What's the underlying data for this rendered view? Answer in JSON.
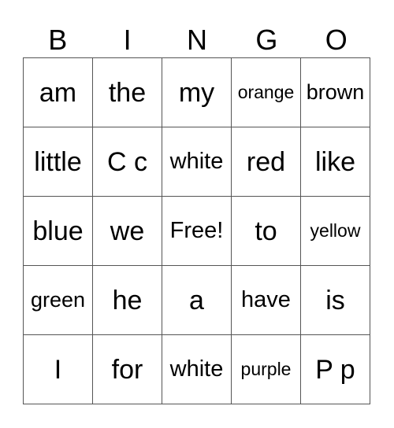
{
  "header": [
    "B",
    "I",
    "N",
    "G",
    "O"
  ],
  "rows": [
    [
      "am",
      "the",
      "my",
      "orange",
      "brown"
    ],
    [
      "little",
      "C c",
      "white",
      "red",
      "like"
    ],
    [
      "blue",
      "we",
      "Free!",
      "to",
      "yellow"
    ],
    [
      "green",
      "he",
      "a",
      "have",
      "is"
    ],
    [
      "I",
      "for",
      "white",
      "purple",
      "P p"
    ]
  ]
}
